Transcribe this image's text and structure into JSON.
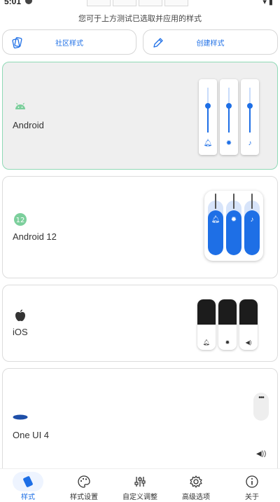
{
  "status_bar": {
    "time": "5:01"
  },
  "hint": "您可于上方测试已选取并应用的样式",
  "top_buttons": {
    "community": "社区样式",
    "create": "创建样式"
  },
  "styles": [
    {
      "name": "Android",
      "selected": true
    },
    {
      "name": "Android 12",
      "selected": false
    },
    {
      "name": "iOS",
      "selected": false
    },
    {
      "name": "One UI 4",
      "selected": false
    }
  ],
  "bottom_nav": [
    {
      "label": "样式",
      "icon": "style-icon",
      "active": true
    },
    {
      "label": "样式设置",
      "icon": "palette-icon",
      "active": false
    },
    {
      "label": "自定义调整",
      "icon": "sliders-icon",
      "active": false
    },
    {
      "label": "高级选项",
      "icon": "gear-icon",
      "active": false
    },
    {
      "label": "关于",
      "icon": "info-icon",
      "active": false
    }
  ],
  "colors": {
    "accent": "#1e6fe6",
    "android_green": "#7ccf9c",
    "selected_border": "#8fd9b6"
  }
}
